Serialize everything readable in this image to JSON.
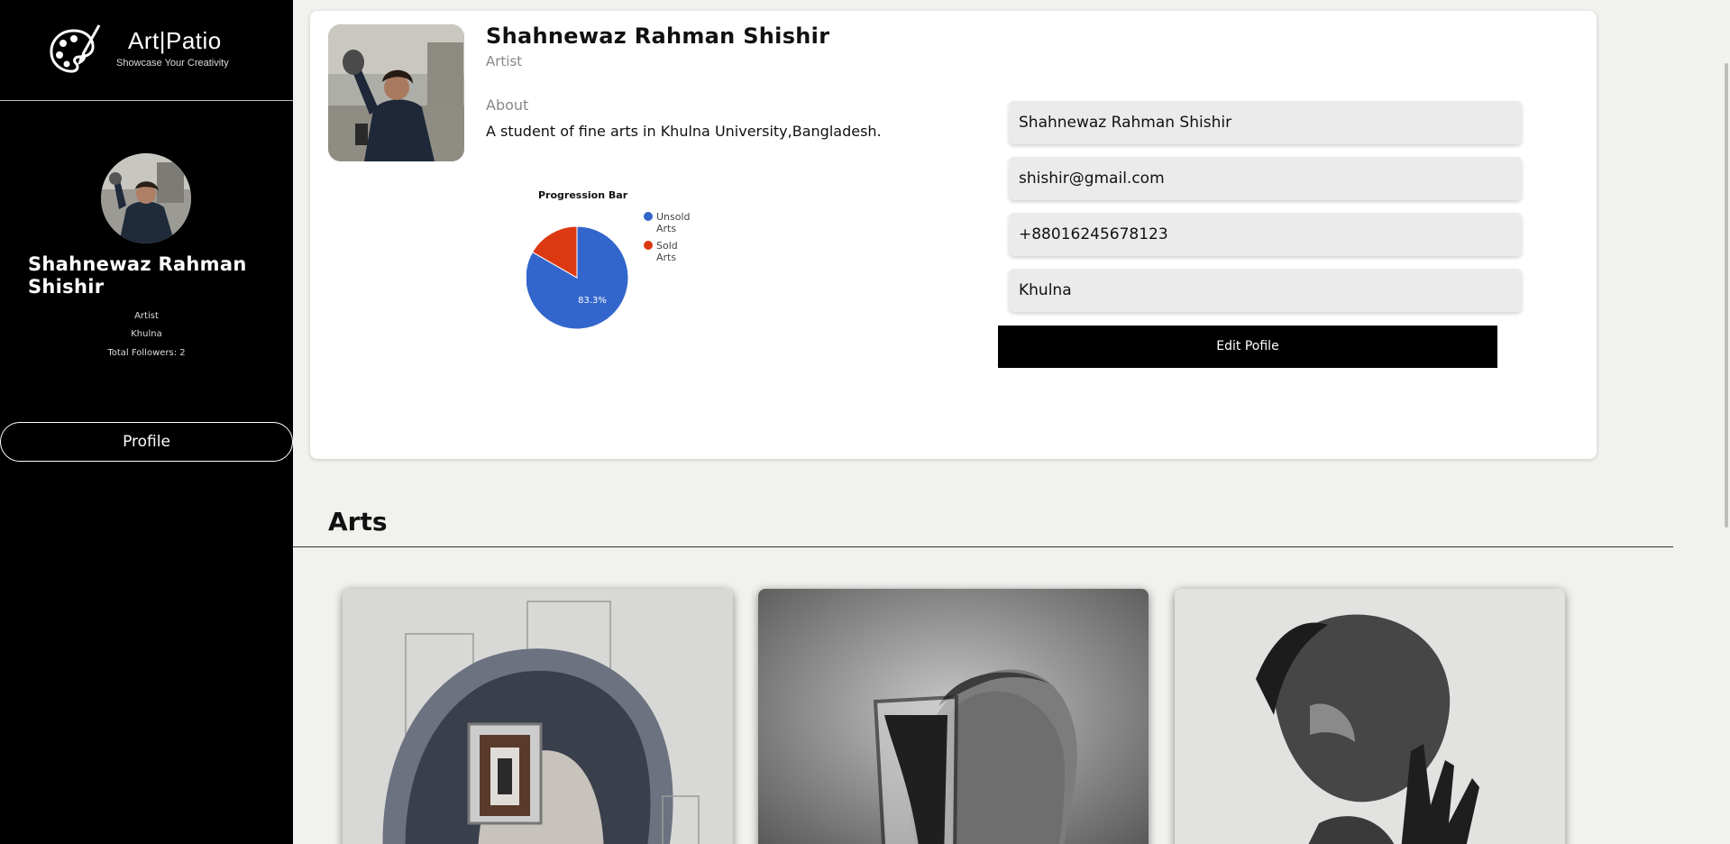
{
  "brand": {
    "name": "Art|Patio",
    "tagline": "Showcase Your Creativity"
  },
  "sidebar": {
    "user_name": "Shahnewaz Rahman Shishir",
    "role": "Artist",
    "location": "Khulna",
    "followers": "Total Followers: 2",
    "profile_button": "Profile"
  },
  "profile": {
    "name": "Shahnewaz Rahman Shishir",
    "role": "Artist",
    "about_label": "About",
    "about_text": "A student of fine arts in Khulna University,Bangladesh.",
    "fields": {
      "name": "Shahnewaz Rahman Shishir",
      "email": "shishir@gmail.com",
      "phone": "+88016245678123",
      "city": "Khulna"
    },
    "edit_button": "Edit Pofile"
  },
  "chart_data": {
    "type": "pie",
    "title": "Progression Bar",
    "slices": [
      {
        "label": "Unsold Arts",
        "value": 83.3,
        "color": "#3366cc"
      },
      {
        "label": "Sold Arts",
        "value": 16.7,
        "color": "#dc3912"
      }
    ],
    "data_label": "83.3%",
    "legend": "right"
  },
  "arts": {
    "title": "Arts"
  },
  "colors": {
    "sidebar_bg": "#000000",
    "page_bg": "#f1f1ee",
    "field_bg": "#ebebeb"
  }
}
